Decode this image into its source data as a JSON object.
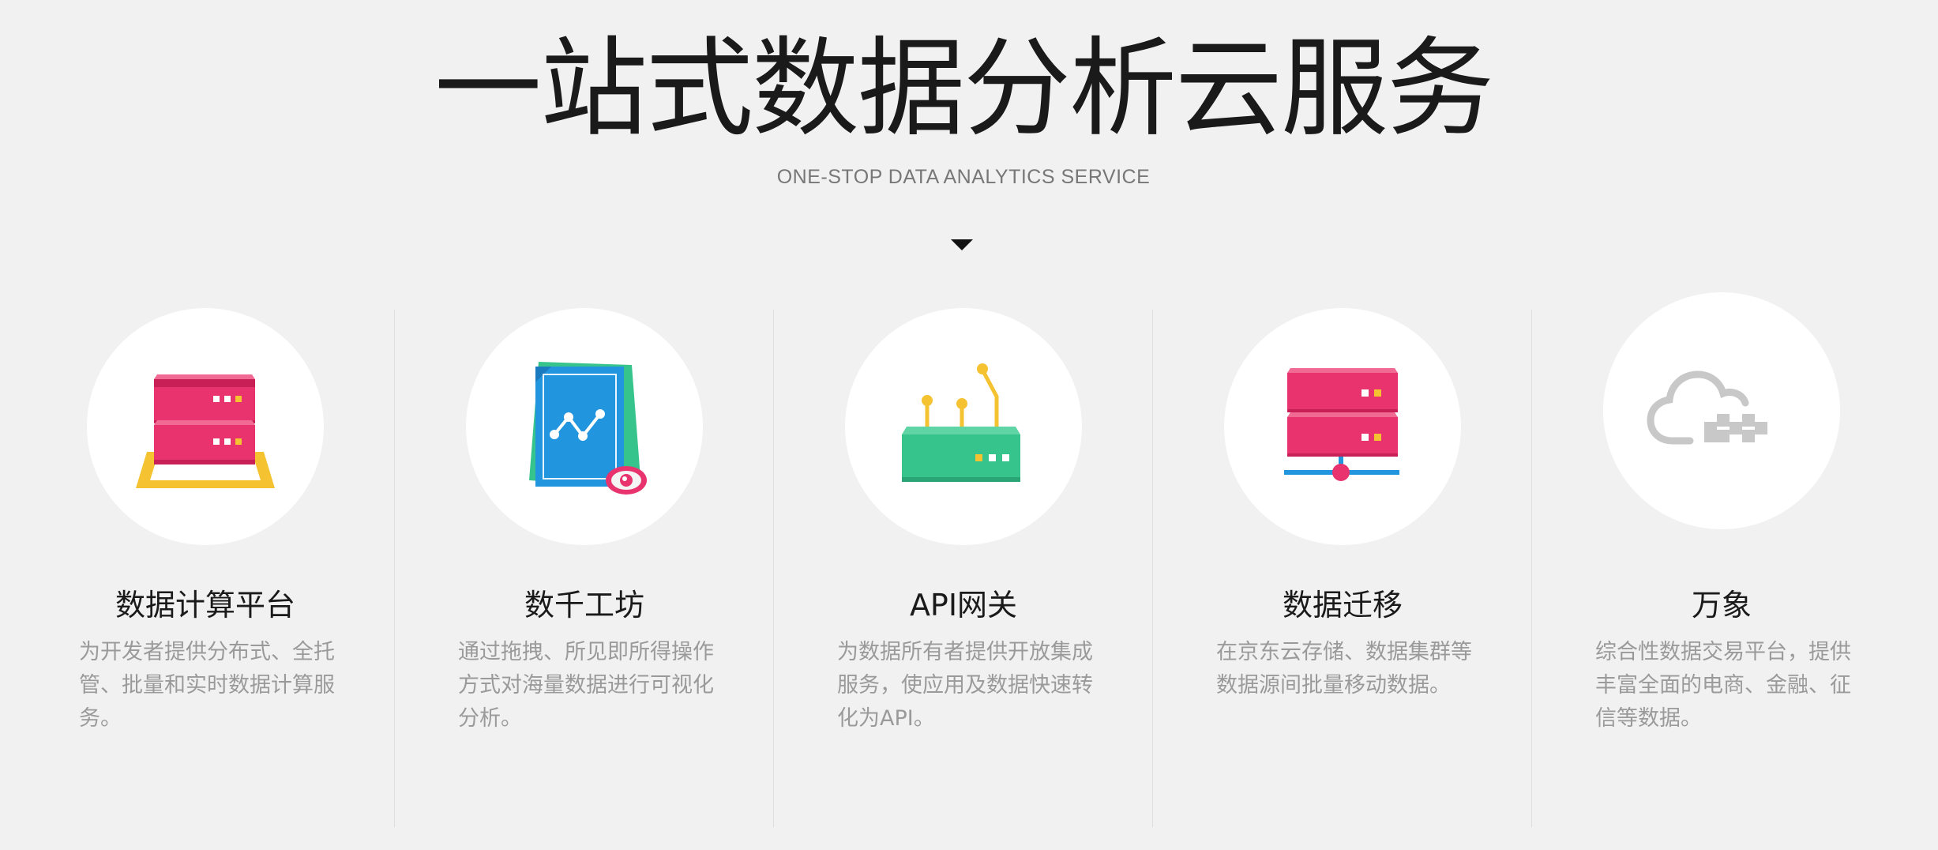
{
  "hero": {
    "title": "一站式数据分析云服务",
    "subtitle": "ONE-STOP DATA ANALYTICS SERVICE",
    "arrow_icon": "triangle-down-icon"
  },
  "colors": {
    "background": "#f1f1f1",
    "pink": "#e8336e",
    "yellow": "#f5c231",
    "blue": "#2196de",
    "green": "#36c48c",
    "gray_icon": "#c8c8c8"
  },
  "cards": [
    {
      "icon": "server-stack-icon",
      "title": "数据计算平台",
      "desc": "为开发者提供分布式、全托管、批量和实时数据计算服务。"
    },
    {
      "icon": "chart-document-icon",
      "title": "数千工坊",
      "desc": "通过拖拽、所见即所得操作方式对海量数据进行可视化分析。"
    },
    {
      "icon": "router-gateway-icon",
      "title": "API网关",
      "desc": "为数据所有者提供开放集成服务，使应用及数据快速转化为API。"
    },
    {
      "icon": "server-network-icon",
      "title": "数据迁移",
      "desc": "在京东云存储、数据集群等数据源间批量移动数据。"
    },
    {
      "icon": "cloud-puzzle-icon",
      "title": "万象",
      "desc": "综合性数据交易平台，提供丰富全面的电商、金融、征信等数据。"
    }
  ]
}
